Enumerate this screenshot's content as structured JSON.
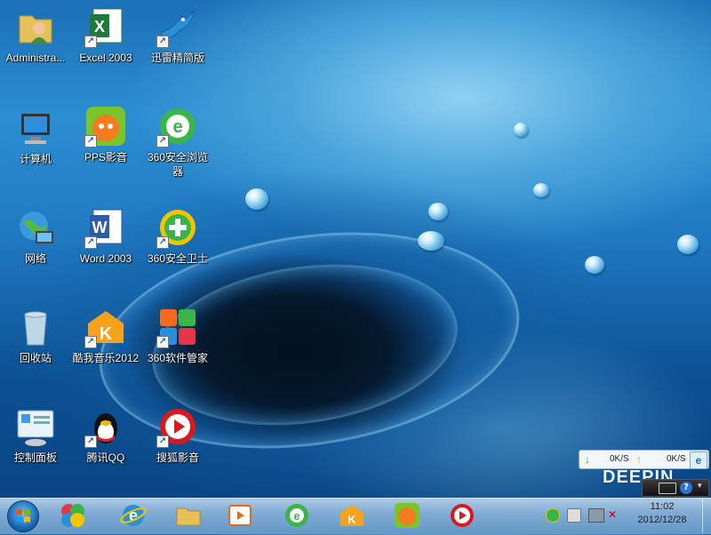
{
  "desktop": {
    "icons": [
      {
        "label": "Administra..."
      },
      {
        "label": "Excel 2003"
      },
      {
        "label": "迅雷精简版"
      },
      {
        "label": "计算机"
      },
      {
        "label": "PPS影音"
      },
      {
        "label": "360安全浏览器"
      },
      {
        "label": "网络"
      },
      {
        "label": "Word 2003"
      },
      {
        "label": "360安全卫士"
      },
      {
        "label": "回收站"
      },
      {
        "label": "酷我音乐2012"
      },
      {
        "label": "360软件管家"
      },
      {
        "label": "控制面板"
      },
      {
        "label": "腾讯QQ"
      },
      {
        "label": "搜狐影音"
      }
    ],
    "watermark": "DEEPIN"
  },
  "netspeed": {
    "down": "0K/S",
    "up": "0K/S"
  },
  "taskbar": {
    "apps": [
      "360-launcher-icon",
      "ie-icon",
      "explorer-icon",
      "media-player-icon",
      "360-browser-icon",
      "kuwo-icon",
      "pps-icon",
      "sohu-video-icon"
    ],
    "clock_time": "11:02",
    "clock_date": "2012/12/28"
  },
  "colors": {
    "accent": "#1f78c0",
    "taskbar": "#9ec2e2"
  }
}
